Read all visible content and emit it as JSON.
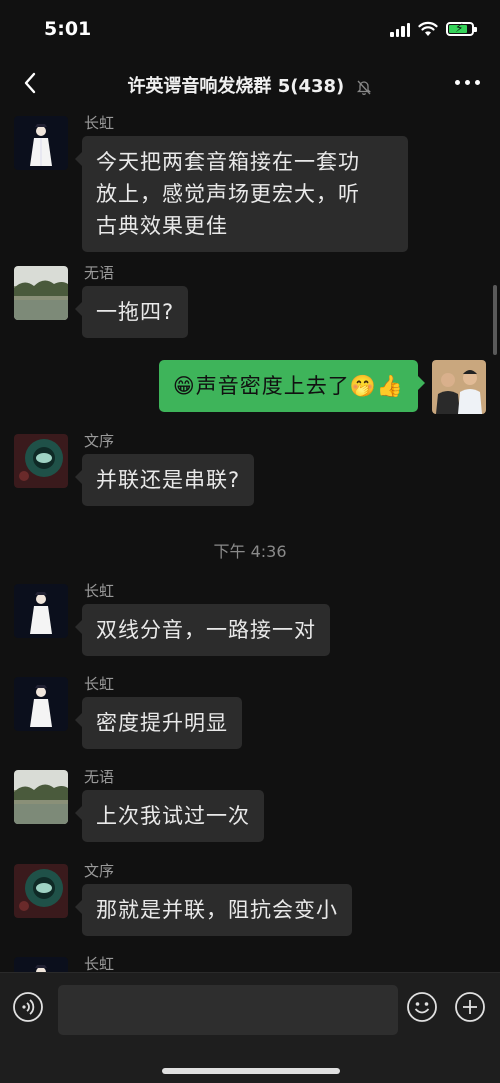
{
  "status_bar": {
    "time": "5:01",
    "battery_color": "#36d35a"
  },
  "header": {
    "title": "许英谔音响发烧群 5(438)",
    "icons": [
      "back-icon",
      "mute-icon",
      "more-icon"
    ]
  },
  "messages": [
    {
      "sender": "长虹",
      "text_lines": [
        "今天把两套音箱接在一套功",
        "放上，感觉声场更宏大，听",
        "古典效果更佳"
      ]
    },
    {
      "sender": "无语",
      "text": "一拖四?"
    },
    {
      "sender": "me",
      "text": "😁声音密度上去了🤭👍"
    },
    {
      "sender": "文序",
      "text": "并联还是串联?"
    },
    {
      "timestamp": "下午 4:36"
    },
    {
      "sender": "长虹",
      "text": "双线分音，一路接一对"
    },
    {
      "sender": "长虹",
      "text": "密度提升明显"
    },
    {
      "sender": "无语",
      "text": "上次我试过一次"
    },
    {
      "sender": "文序",
      "text": "那就是并联，阻抗会变小"
    },
    {
      "sender": "长虹",
      "text": ""
    }
  ],
  "colors": {
    "background": "#111111",
    "bubble_incoming": "#2c2c2c",
    "bubble_outgoing": "#3eb45a"
  },
  "input_bar": {
    "icons": [
      "voice-icon",
      "emoji-icon",
      "plus-icon"
    ]
  }
}
